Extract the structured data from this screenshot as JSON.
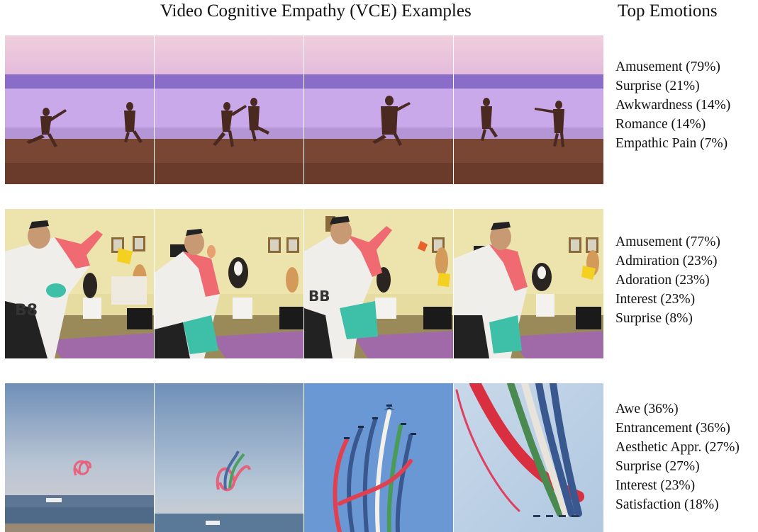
{
  "header": {
    "title": "Video Cognitive Empathy (VCE) Examples",
    "emotions_title": "Top Emotions"
  },
  "examples": [
    {
      "scene": "beach-couple-running",
      "emotions": [
        "Amusement (79%)",
        "Surprise (21%)",
        "Awkwardness (14%)",
        "Romance (14%)",
        "Empathic Pain (7%)"
      ]
    },
    {
      "scene": "man-dog-frisbee",
      "emotions": [
        "Amusement (77%)",
        "Admiration (23%)",
        "Adoration (23%)",
        "Interest (23%)",
        "Surprise (8%)"
      ]
    },
    {
      "scene": "jets-airshow",
      "emotions": [
        "Awe (36%)",
        "Entrancement (36%)",
        "Aesthetic Appr. (27%)",
        "Surprise (27%)",
        "Interest (23%)",
        "Satisfaction (18%)"
      ]
    }
  ]
}
